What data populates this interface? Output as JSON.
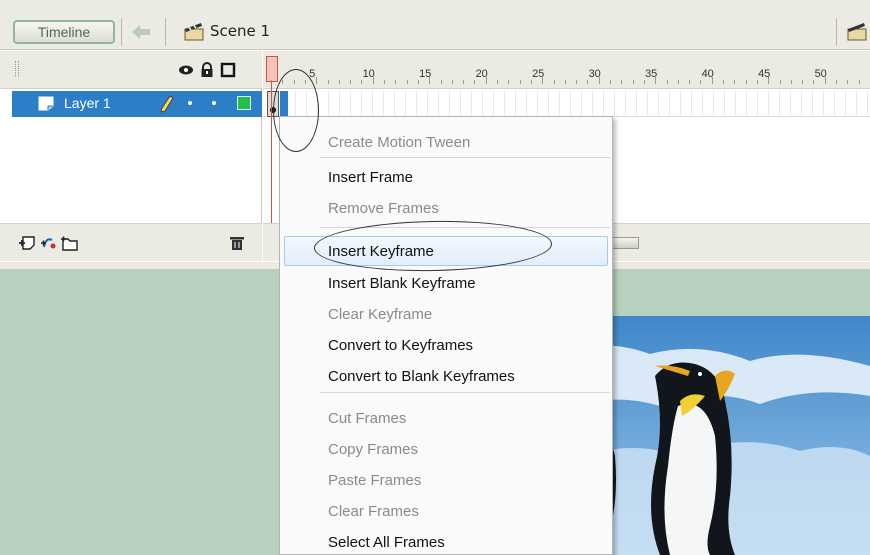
{
  "toolbar": {
    "timeline_label": "Timeline",
    "scene_label": "Scene 1"
  },
  "layers": {
    "rows": [
      {
        "name": "Layer 1",
        "selected": true,
        "color": "#22c24a"
      }
    ]
  },
  "ruler": {
    "numbers": [
      "5",
      "10",
      "15",
      "20",
      "25",
      "30",
      "35",
      "40",
      "45",
      "50"
    ]
  },
  "context_menu": {
    "items": [
      {
        "label": "Create Motion Tween",
        "enabled": false
      },
      {
        "label": "Insert Frame",
        "enabled": true
      },
      {
        "label": "Remove Frames",
        "enabled": false
      },
      {
        "label": "Insert Keyframe",
        "enabled": true,
        "highlighted": true
      },
      {
        "label": "Insert Blank Keyframe",
        "enabled": true
      },
      {
        "label": "Clear Keyframe",
        "enabled": false
      },
      {
        "label": "Convert to Keyframes",
        "enabled": true
      },
      {
        "label": "Convert to Blank Keyframes",
        "enabled": true
      },
      {
        "label": "Cut Frames",
        "enabled": false
      },
      {
        "label": "Copy Frames",
        "enabled": false
      },
      {
        "label": "Paste Frames",
        "enabled": false
      },
      {
        "label": "Clear Frames",
        "enabled": false
      },
      {
        "label": "Select All Frames",
        "enabled": true
      }
    ]
  },
  "colors": {
    "selection_blue": "#2c7fc7",
    "stage_green": "#b7d1be",
    "playhead_red": "#d8503a"
  }
}
